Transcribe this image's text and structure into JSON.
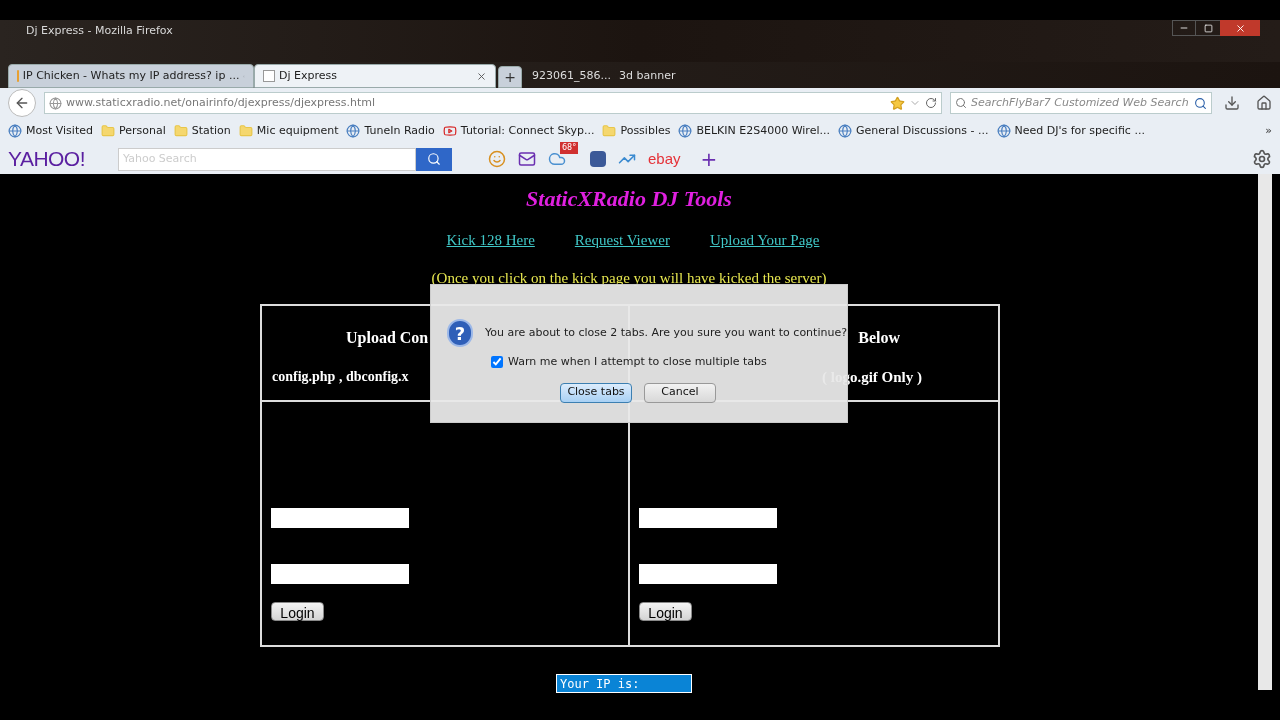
{
  "window": {
    "title": "Dj Express - Mozilla Firefox"
  },
  "desktop_labels": [
    "923061_586...",
    "3d banner"
  ],
  "tabs": [
    {
      "label": "IP Chicken - Whats my IP address? ip ...",
      "selected": false
    },
    {
      "label": "Dj Express",
      "selected": true
    }
  ],
  "new_tab": "+",
  "address": "www.staticxradio.net/onairinfo/djexpress/djexpress.html",
  "search": {
    "placeholder": "SearchFlyBar7 Customized Web Search"
  },
  "bookmarks": [
    {
      "label": "Most Visited",
      "kind": "site"
    },
    {
      "label": "Personal",
      "kind": "folder"
    },
    {
      "label": "Station",
      "kind": "folder"
    },
    {
      "label": "Mic equipment",
      "kind": "folder"
    },
    {
      "label": "TuneIn Radio",
      "kind": "site"
    },
    {
      "label": "Tutorial: Connect Skyp...",
      "kind": "video"
    },
    {
      "label": "Possibles",
      "kind": "folder"
    },
    {
      "label": "BELKIN E2S4000 Wirel...",
      "kind": "site"
    },
    {
      "label": "General Discussions - ...",
      "kind": "site"
    },
    {
      "label": "Need DJ's for specific ...",
      "kind": "site"
    }
  ],
  "bookmarks_more": "»",
  "yahoo": {
    "logo": "YAHOO!",
    "placeholder": "Yahoo Search",
    "weather": "68°",
    "ebay": "ebay",
    "add": "+"
  },
  "page": {
    "title": "StaticXRadio DJ Tools",
    "links": [
      "Kick 128 Here",
      "Request Viewer",
      "Upload Your Page"
    ],
    "note": "(Once you click on the kick page you will have kicked the server)",
    "left": {
      "heading": "Upload Con",
      "files": "config.php , dbconfig.x",
      "button": "Login"
    },
    "right": {
      "heading": "Below",
      "files": "( logo.gif  Only )",
      "button": "Login"
    },
    "ip": "Your IP is:"
  },
  "dialog": {
    "icon": "?",
    "message": "You are about to close 2 tabs. Are you sure you want to continue?",
    "checkbox": {
      "label": "Warn me when I attempt to close multiple tabs",
      "checked": true
    },
    "buttons": [
      "Close tabs",
      "Cancel"
    ]
  }
}
